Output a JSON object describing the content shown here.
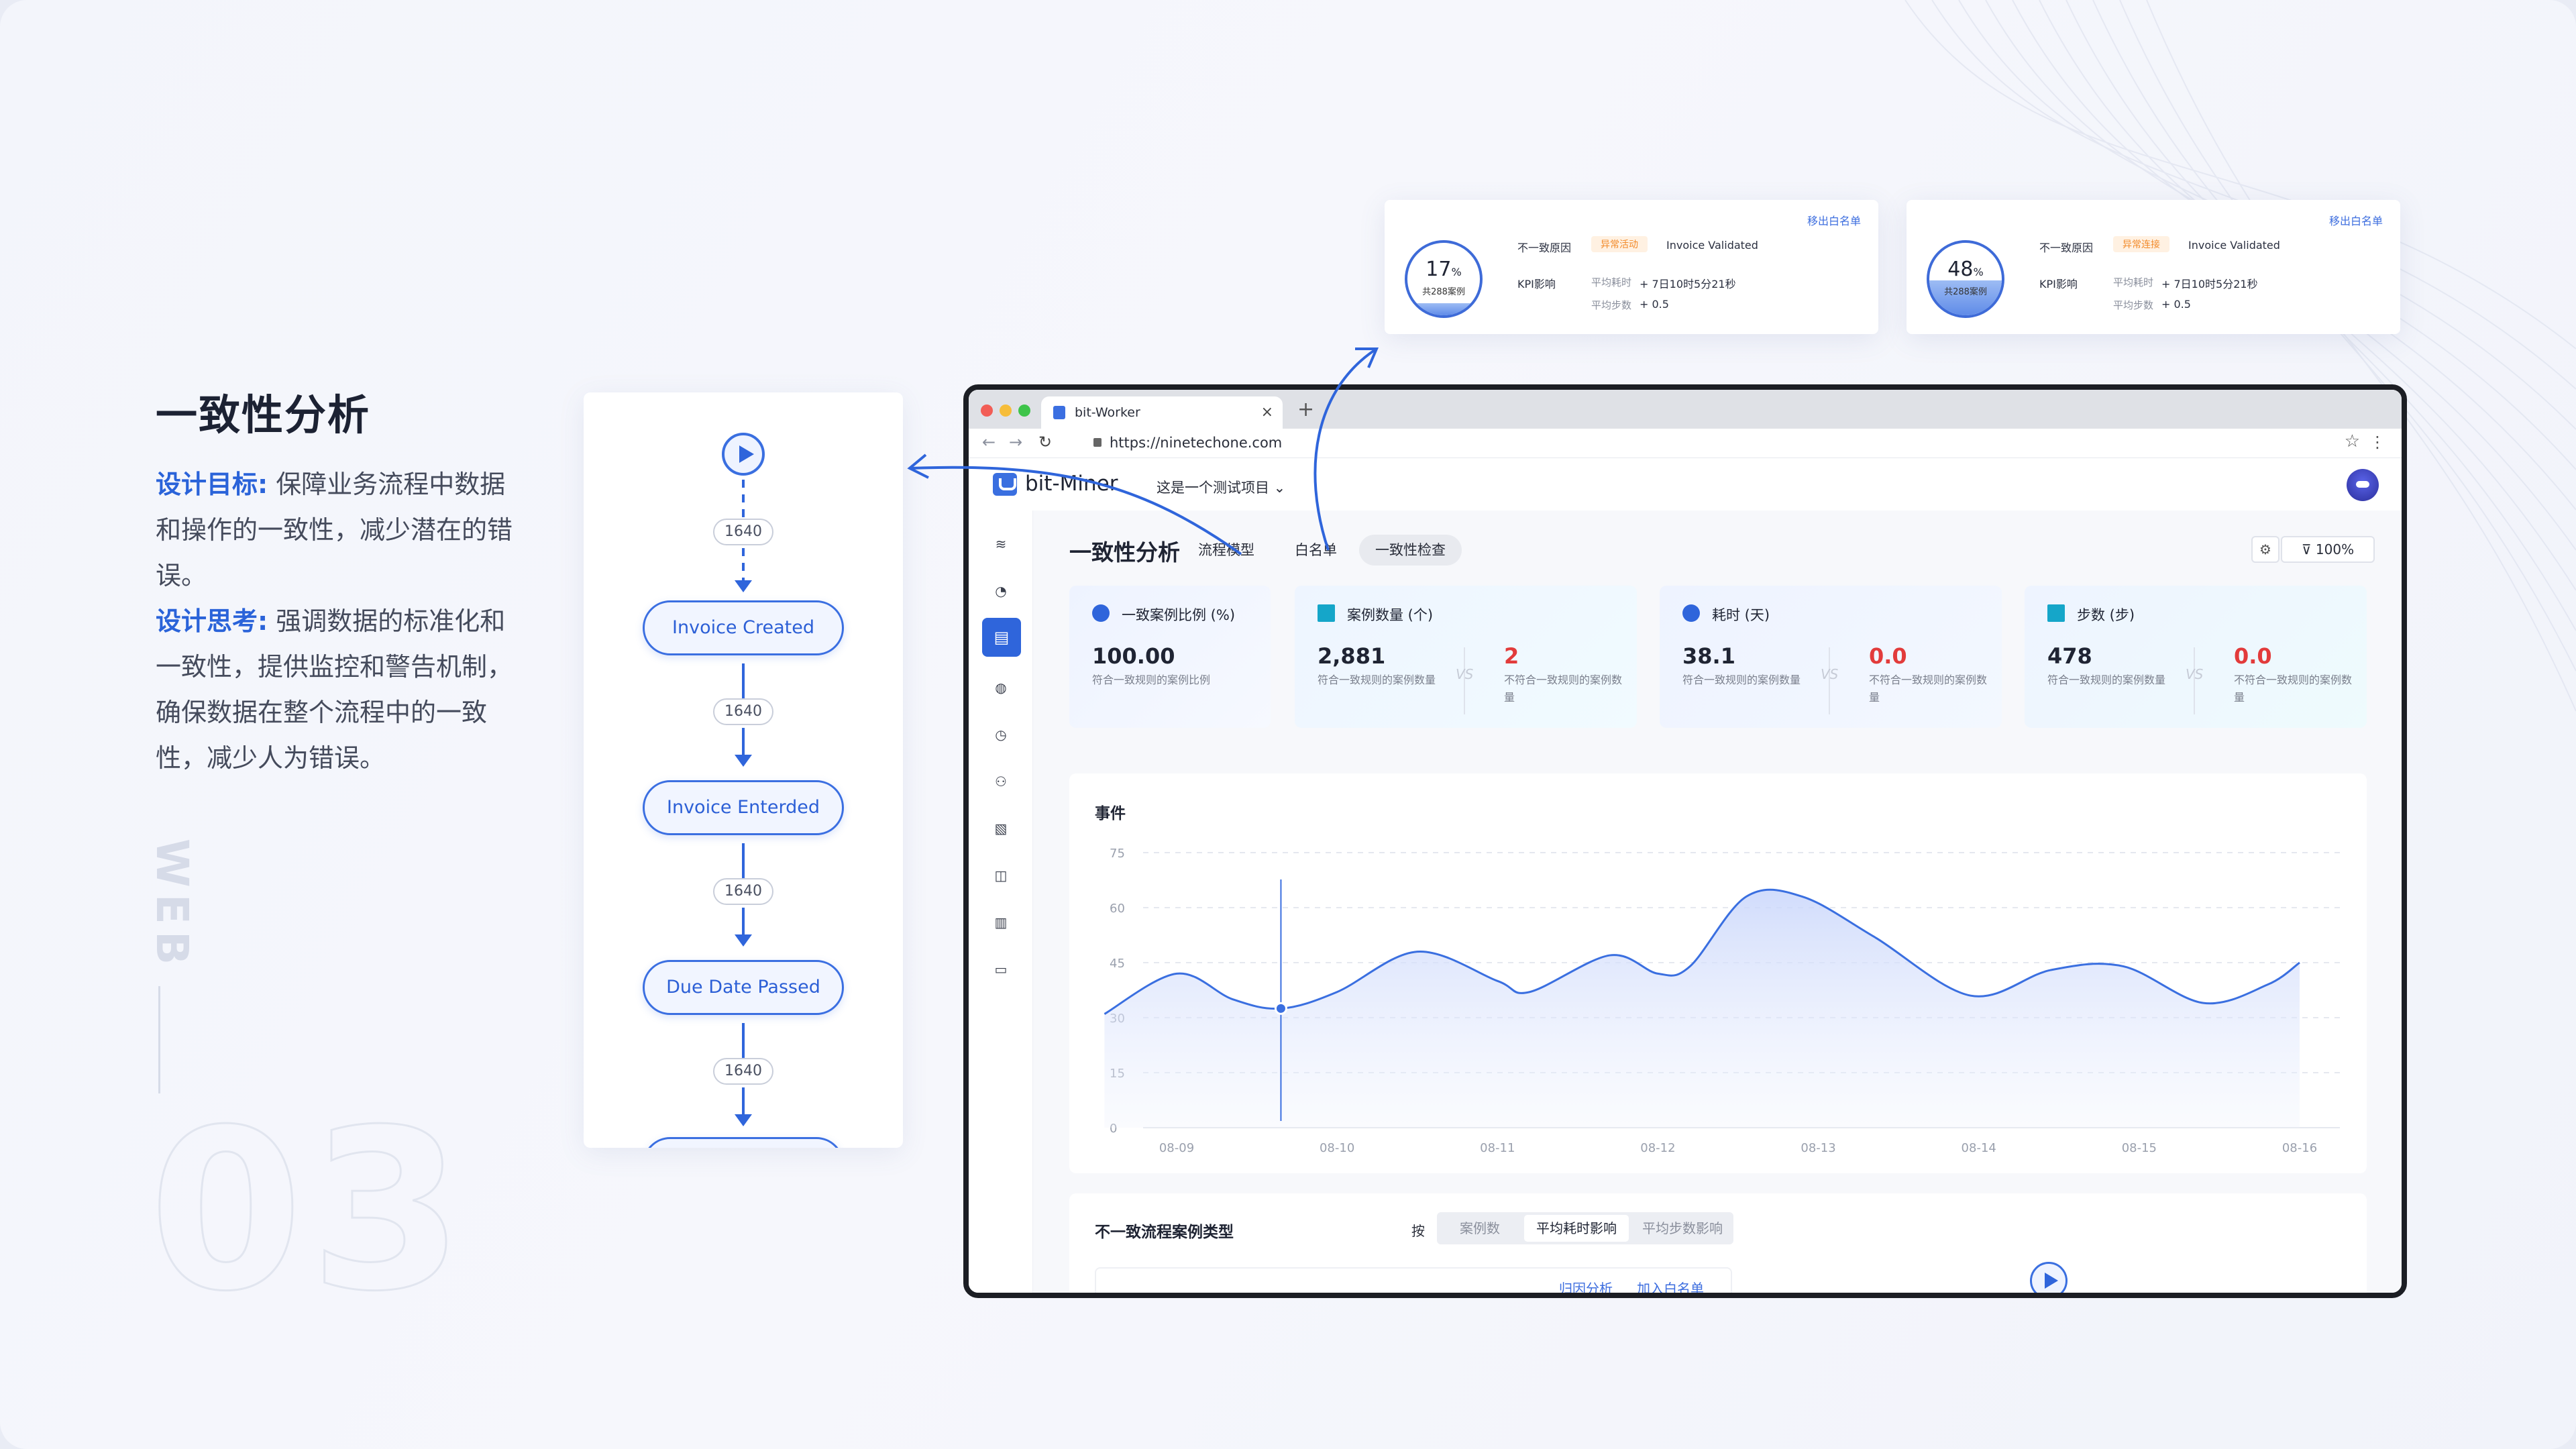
{
  "slide": {
    "heading": "一致性分析",
    "goal_label": "设计目标:",
    "goal_text": "保障业务流程中数据和操作的一致性，减少潜在的错误。",
    "thinking_label": "设计思考:",
    "thinking_text": "强调数据的标准化和一致性，提供监控和警告机制，确保数据在整个流程中的一致性，减少人为错误。",
    "vertical_label": "WEB",
    "section_number": "03"
  },
  "flow": {
    "nodes": [
      "Invoice Created",
      "Invoice Enterded",
      "Due Date Passed"
    ],
    "counts": [
      "1640",
      "1640",
      "1640",
      "1640"
    ]
  },
  "popups": [
    {
      "percent": "17",
      "percent_unit": "%",
      "cases": "共288案例",
      "fill": 0.17,
      "remove": "移出白名单",
      "reason_label": "不一致原因",
      "reason_tag": "异常活动",
      "reason_value": "Invoice Validated",
      "kpi_label": "KPI影响",
      "avg_time_label": "平均耗时",
      "avg_time_value": "+ 7日10时5分21秒",
      "avg_steps_label": "平均步数",
      "avg_steps_value": "+ 0.5"
    },
    {
      "percent": "48",
      "percent_unit": "%",
      "cases": "共288案例",
      "fill": 0.48,
      "remove": "移出白名单",
      "reason_label": "不一致原因",
      "reason_tag": "异常连接",
      "reason_value": "Invoice Validated",
      "kpi_label": "KPI影响",
      "avg_time_label": "平均耗时",
      "avg_time_value": "+ 7日10时5分21秒",
      "avg_steps_label": "平均步数",
      "avg_steps_value": "+ 0.5"
    }
  ],
  "browser": {
    "tab_title": "bit-Worker",
    "tab_close": "×",
    "new_tab": "+",
    "url": "https://ninetechone.com"
  },
  "app": {
    "brand": "bit-Miner",
    "project": "这是一个测试项目 ⌄",
    "page_title": "一致性分析",
    "tabs": [
      "流程模型",
      "白名单",
      "一致性检查"
    ],
    "active_tab": "一致性检查",
    "zoom": "100%",
    "kpis": [
      {
        "title": "一致案例比例 (%)",
        "value": "100.00",
        "desc": "符合一致规则的案例比例",
        "accent": "#2f65db"
      },
      {
        "title": "案例数量 (个)",
        "value": "2,881",
        "desc": "符合一致规则的案例数量",
        "vs": "VS",
        "value2": "2",
        "desc2": "不符合一致规则的案例数量",
        "accent": "#15a6c9"
      },
      {
        "title": "耗时 (天)",
        "value": "38.1",
        "desc": "符合一致规则的案例数量",
        "vs": "VS",
        "value2": "0.0",
        "desc2": "不符合一致规则的案例数量",
        "accent": "#2f65db"
      },
      {
        "title": "步数 (步)",
        "value": "478",
        "desc": "符合一致规则的案例数量",
        "vs": "VS",
        "value2": "0.0",
        "desc2": "不符合一致规则的案例数量",
        "accent": "#15a6c9"
      }
    ],
    "bottom": {
      "title": "不一致流程案例类型",
      "by": "按",
      "segments": [
        "案例数",
        "平均耗时影响",
        "平均步数影响"
      ],
      "active_segment": "平均耗时影响",
      "links": [
        "归因分析",
        "加入白名单"
      ]
    }
  },
  "chart_data": {
    "type": "area",
    "title": "事件",
    "x": [
      "08-09",
      "08-10",
      "08-11",
      "08-12",
      "08-13",
      "08-14",
      "08-15",
      "08-16"
    ],
    "y_ticks": [
      0,
      15,
      30,
      45,
      60,
      75
    ],
    "ylim": [
      0,
      75
    ],
    "series": [
      {
        "points": [
          [
            -0.45,
            31
          ],
          [
            0,
            42
          ],
          [
            0.35,
            35
          ],
          [
            0.65,
            32.5
          ],
          [
            1,
            37
          ],
          [
            1.5,
            48
          ],
          [
            2,
            40
          ],
          [
            2.2,
            37
          ],
          [
            2.7,
            47
          ],
          [
            3,
            42
          ],
          [
            3.2,
            44
          ],
          [
            3.55,
            63
          ],
          [
            3.9,
            63
          ],
          [
            4.35,
            52
          ],
          [
            4.95,
            36
          ],
          [
            5.45,
            43
          ],
          [
            5.9,
            44
          ],
          [
            6.4,
            34
          ],
          [
            6.8,
            39
          ],
          [
            7,
            45
          ]
        ]
      }
    ],
    "highlight_x": 0.65,
    "grid": true,
    "color": "#3a6fe0"
  }
}
